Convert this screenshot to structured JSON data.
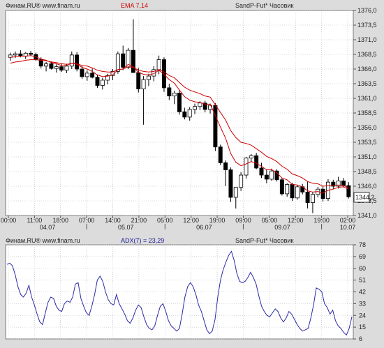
{
  "colors": {
    "background": "#dcdcdc",
    "plot_background": "#ffffff",
    "grid": "#b8b8b8",
    "candle_up": "#ffffff",
    "candle_down": "#000000",
    "ema_fast": "#cc0000",
    "ema_slow": "#cc0000",
    "adx_line": "#2a2aa8",
    "adx_label": "#1a1a9a",
    "ema_label": "#cc0000",
    "header_text": "#222222"
  },
  "price_panel": {
    "source": "Финам.RU® www.finam.ru",
    "indicator_label": "EMA 7,14",
    "symbol": "SandP-Fut* Часовик",
    "last_price": "1344,2"
  },
  "adx_panel": {
    "source": "Финам.RU® www.finam.ru",
    "indicator_label": "ADX(7) = 23,29",
    "symbol": "SandP-Fut* Часовик"
  },
  "chart_data": [
    {
      "type": "candlestick",
      "title": "SandP-Fut* Часовик",
      "y_ticks": [
        "1376,0",
        "1373,5",
        "1371,0",
        "1368,5",
        "1366,0",
        "1363,5",
        "1361,0",
        "1358,5",
        "1356,0",
        "1353,5",
        "1351,0",
        "1348,5",
        "1346,0",
        "1343,5",
        "1341,0"
      ],
      "ylim": [
        1341.0,
        1376.0
      ],
      "x_time_ticks": [
        "00:00",
        "11:00",
        "18:00",
        "07:00",
        "14:00",
        "21:00",
        "05:00",
        "12:00",
        "19:00",
        "09:00",
        "05:00",
        "12:00",
        "19:00",
        "02:00"
      ],
      "x_date_ticks": [
        "04.07",
        "05.07",
        "06.07",
        "09.07",
        "10.07"
      ],
      "last_price": 1344.2,
      "grid": true,
      "candles": [
        [
          1368.0,
          1368.8,
          1367.4,
          1368.4
        ],
        [
          1368.4,
          1369.0,
          1367.9,
          1368.6
        ],
        [
          1368.6,
          1369.2,
          1368.0,
          1368.2
        ],
        [
          1368.2,
          1368.9,
          1367.7,
          1368.7
        ],
        [
          1368.7,
          1369.1,
          1368.2,
          1368.5
        ],
        [
          1368.5,
          1368.8,
          1367.4,
          1367.6
        ],
        [
          1367.6,
          1368.0,
          1366.1,
          1366.5
        ],
        [
          1366.5,
          1367.2,
          1365.6,
          1366.9
        ],
        [
          1366.9,
          1367.3,
          1365.9,
          1366.1
        ],
        [
          1366.1,
          1366.8,
          1365.4,
          1366.4
        ],
        [
          1366.4,
          1367.0,
          1365.5,
          1365.8
        ],
        [
          1365.8,
          1366.9,
          1365.3,
          1366.5
        ],
        [
          1366.5,
          1369.0,
          1366.0,
          1368.4
        ],
        [
          1368.4,
          1368.9,
          1365.6,
          1366.0
        ],
        [
          1366.0,
          1366.5,
          1364.3,
          1364.7
        ],
        [
          1364.7,
          1365.8,
          1364.0,
          1365.3
        ],
        [
          1365.3,
          1366.1,
          1364.4,
          1364.6
        ],
        [
          1364.6,
          1365.0,
          1362.8,
          1363.2
        ],
        [
          1363.2,
          1364.5,
          1362.5,
          1364.1
        ],
        [
          1364.1,
          1365.2,
          1363.4,
          1364.9
        ],
        [
          1364.9,
          1366.0,
          1364.1,
          1365.6
        ],
        [
          1365.6,
          1369.0,
          1365.2,
          1368.6
        ],
        [
          1368.6,
          1370.0,
          1365.8,
          1366.3
        ],
        [
          1366.3,
          1369.6,
          1366.0,
          1369.2
        ],
        [
          1369.2,
          1374.5,
          1368.8,
          1365.4
        ],
        [
          1365.4,
          1366.2,
          1362.0,
          1362.6
        ],
        [
          1362.6,
          1364.8,
          1356.5,
          1364.2
        ],
        [
          1364.2,
          1365.2,
          1363.1,
          1364.8
        ],
        [
          1364.8,
          1366.5,
          1363.9,
          1365.9
        ],
        [
          1365.9,
          1368.3,
          1365.1,
          1367.6
        ],
        [
          1367.6,
          1368.0,
          1362.1,
          1362.8
        ],
        [
          1362.8,
          1363.5,
          1360.7,
          1361.4
        ],
        [
          1361.4,
          1362.3,
          1360.0,
          1361.9
        ],
        [
          1361.9,
          1362.5,
          1358.2,
          1358.7
        ],
        [
          1358.7,
          1359.4,
          1357.4,
          1357.8
        ],
        [
          1357.8,
          1359.5,
          1357.2,
          1359.1
        ],
        [
          1359.1,
          1360.1,
          1358.3,
          1359.6
        ],
        [
          1359.6,
          1360.5,
          1359.0,
          1360.2
        ],
        [
          1360.2,
          1360.6,
          1358.6,
          1359.1
        ],
        [
          1359.1,
          1360.1,
          1358.4,
          1359.8
        ],
        [
          1359.8,
          1360.2,
          1352.0,
          1352.7
        ],
        [
          1352.7,
          1353.1,
          1349.6,
          1350.0
        ],
        [
          1350.0,
          1350.4,
          1346.0,
          1348.8
        ],
        [
          1348.8,
          1349.2,
          1343.3,
          1344.1
        ],
        [
          1344.1,
          1344.6,
          1342.2,
          1345.8
        ],
        [
          1345.8,
          1348.4,
          1345.2,
          1347.9
        ],
        [
          1347.9,
          1351.0,
          1347.3,
          1350.8
        ],
        [
          1350.8,
          1351.5,
          1350.1,
          1351.2
        ],
        [
          1351.2,
          1351.7,
          1348.9,
          1349.1
        ],
        [
          1349.1,
          1350.0,
          1347.4,
          1347.9
        ],
        [
          1347.9,
          1348.8,
          1346.5,
          1347.2
        ],
        [
          1347.2,
          1349.0,
          1346.9,
          1348.6
        ],
        [
          1348.6,
          1348.9,
          1346.8,
          1347.1
        ],
        [
          1347.1,
          1347.4,
          1344.4,
          1344.7
        ],
        [
          1344.7,
          1346.5,
          1344.2,
          1346.3
        ],
        [
          1346.3,
          1346.6,
          1343.5,
          1344.0
        ],
        [
          1344.0,
          1346.2,
          1343.7,
          1345.9
        ],
        [
          1345.9,
          1346.4,
          1344.6,
          1345.0
        ],
        [
          1345.0,
          1346.8,
          1342.2,
          1343.2
        ],
        [
          1343.2,
          1345.0,
          1341.4,
          1344.6
        ],
        [
          1344.6,
          1345.9,
          1344.1,
          1345.5
        ],
        [
          1345.5,
          1346.0,
          1343.4,
          1343.9
        ],
        [
          1343.9,
          1347.2,
          1343.5,
          1346.7
        ],
        [
          1346.7,
          1347.1,
          1345.5,
          1346.0
        ],
        [
          1346.0,
          1347.6,
          1345.6,
          1346.9
        ],
        [
          1346.9,
          1347.4,
          1345.8,
          1346.1
        ],
        [
          1346.1,
          1346.7,
          1343.9,
          1344.2
        ]
      ],
      "ema_7": [
        1368.0,
        1368.1,
        1368.2,
        1368.2,
        1368.3,
        1368.1,
        1367.7,
        1367.5,
        1367.1,
        1366.9,
        1366.6,
        1366.6,
        1367.0,
        1366.8,
        1366.3,
        1366.0,
        1365.6,
        1365.0,
        1364.7,
        1364.8,
        1365.0,
        1365.9,
        1366.0,
        1366.8,
        1366.4,
        1365.4,
        1365.1,
        1365.0,
        1365.2,
        1365.8,
        1365.1,
        1364.2,
        1363.6,
        1362.4,
        1361.3,
        1360.7,
        1360.4,
        1360.3,
        1360.0,
        1360.0,
        1358.1,
        1356.1,
        1354.2,
        1351.6,
        1350.1,
        1349.5,
        1349.8,
        1350.2,
        1349.9,
        1349.4,
        1348.8,
        1348.8,
        1348.3,
        1347.4,
        1347.1,
        1346.3,
        1346.2,
        1345.9,
        1345.2,
        1345.0,
        1345.1,
        1344.8,
        1345.3,
        1345.5,
        1345.8,
        1345.9,
        1345.5
      ],
      "ema_14": [
        1367.0,
        1367.2,
        1367.3,
        1367.5,
        1367.6,
        1367.6,
        1367.5,
        1367.4,
        1367.2,
        1367.1,
        1366.9,
        1366.8,
        1367.0,
        1366.9,
        1366.6,
        1366.5,
        1366.2,
        1365.8,
        1365.6,
        1365.5,
        1365.5,
        1365.9,
        1366.0,
        1366.4,
        1366.3,
        1365.8,
        1365.6,
        1365.5,
        1365.6,
        1365.9,
        1365.5,
        1364.9,
        1364.5,
        1363.7,
        1362.9,
        1362.4,
        1362.1,
        1361.8,
        1361.4,
        1361.2,
        1359.9,
        1358.6,
        1357.3,
        1355.5,
        1354.3,
        1353.5,
        1353.3,
        1353.0,
        1352.4,
        1351.8,
        1351.1,
        1350.7,
        1350.2,
        1349.4,
        1348.9,
        1348.1,
        1347.8,
        1347.4,
        1346.8,
        1346.5,
        1346.4,
        1346.0,
        1346.1,
        1346.1,
        1346.2,
        1346.1,
        1345.8
      ]
    },
    {
      "type": "line",
      "title": "ADX(7) = 23,29",
      "y_ticks": [
        "78",
        "69",
        "60",
        "51",
        "42",
        "33",
        "24",
        "15",
        "6"
      ],
      "ylim": [
        6,
        78
      ],
      "grid": true,
      "series": [
        {
          "name": "ADX(7)",
          "values": [
            63,
            64,
            62,
            55,
            46,
            40,
            38,
            41,
            47,
            38,
            32,
            25,
            19,
            17,
            26,
            34,
            38,
            37,
            31,
            28,
            27,
            33,
            35,
            34,
            38,
            48,
            49,
            37,
            31,
            26,
            24,
            31,
            40,
            51,
            54,
            50,
            42,
            36,
            33,
            32,
            40,
            33,
            29,
            25,
            20,
            18,
            22,
            28,
            32,
            30,
            23,
            17,
            14,
            13,
            16,
            24,
            31,
            33,
            27,
            20,
            16,
            14,
            12,
            14,
            25,
            38,
            46,
            49,
            46,
            40,
            32,
            27,
            20,
            13,
            10,
            12,
            21,
            38,
            51,
            59,
            65,
            70,
            73,
            66,
            56,
            50,
            49,
            50,
            53,
            57,
            53,
            48,
            39,
            31,
            27,
            24,
            23,
            26,
            29,
            27,
            22,
            19,
            22,
            27,
            25,
            21,
            17,
            14,
            12,
            13,
            14,
            22,
            32,
            45,
            44,
            42,
            33,
            30,
            25,
            28,
            20,
            16,
            14,
            11,
            9,
            14,
            23
          ]
        }
      ]
    }
  ]
}
